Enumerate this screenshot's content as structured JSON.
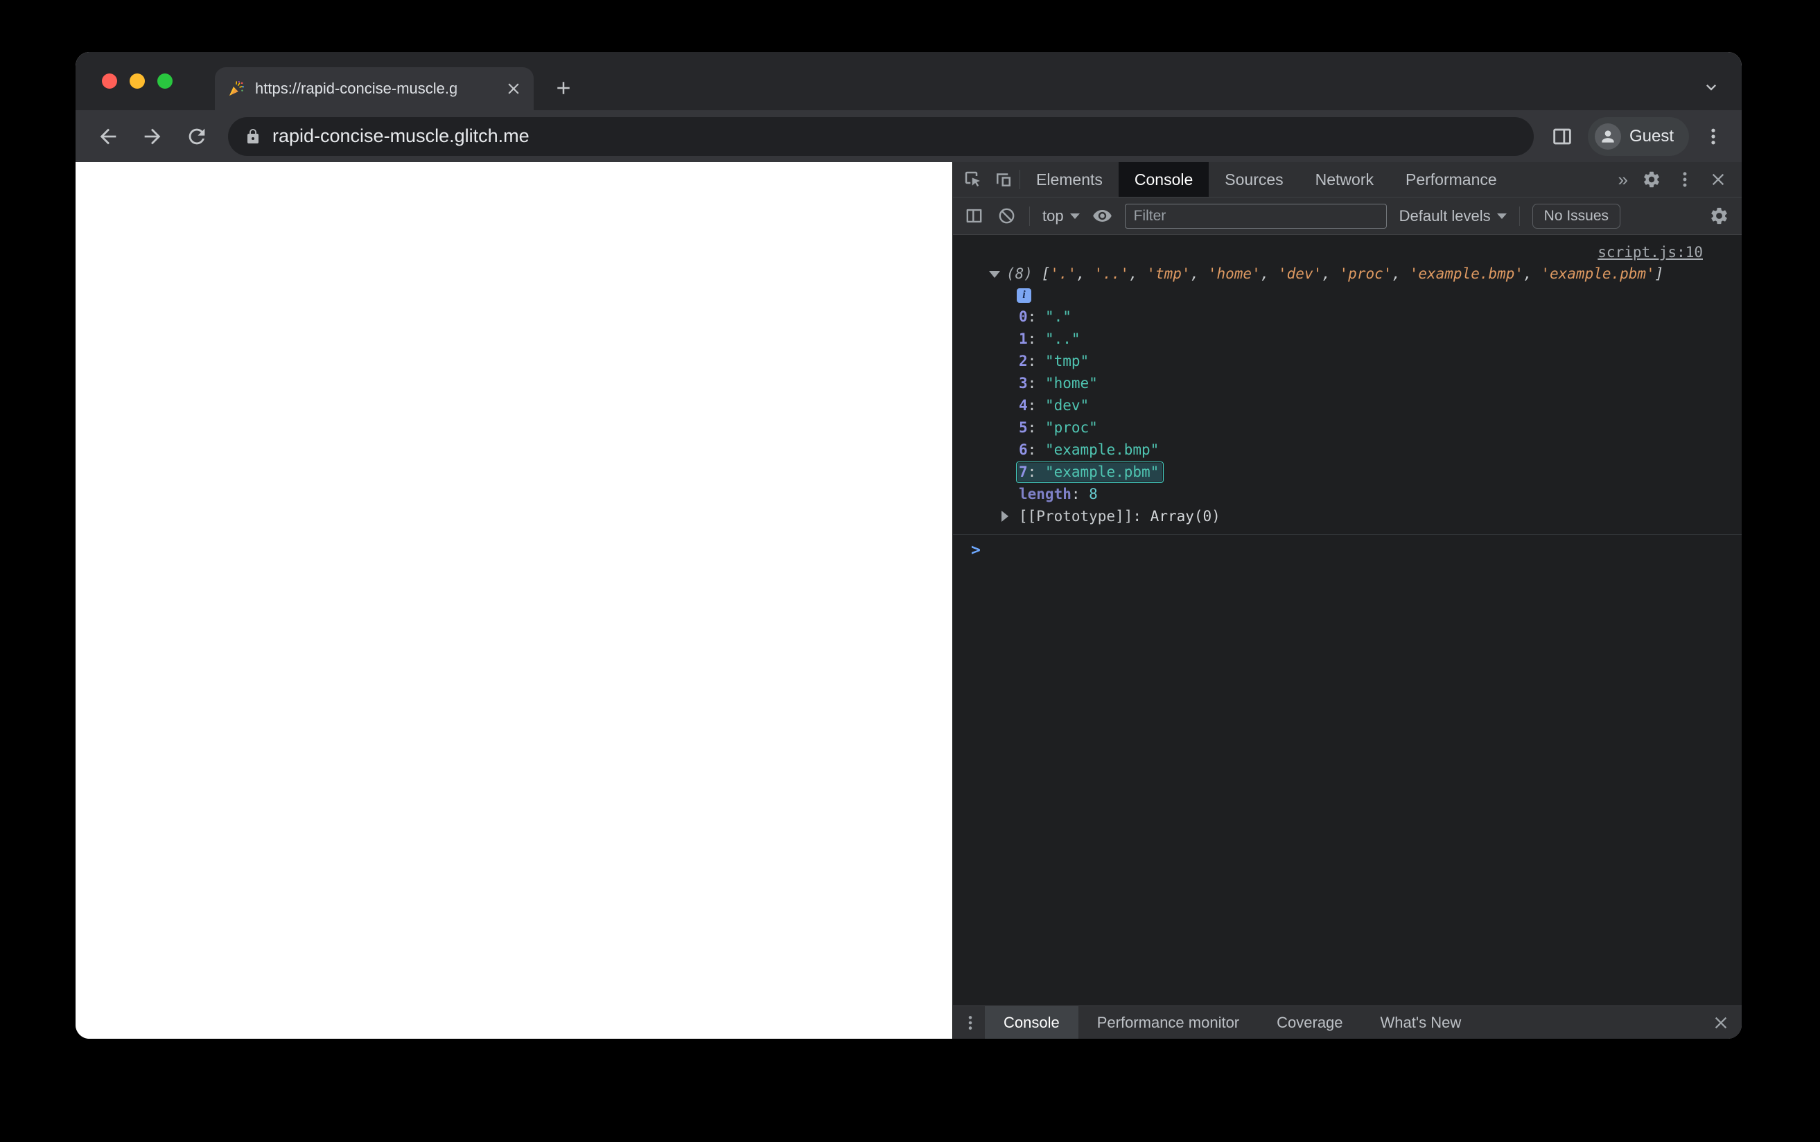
{
  "browser": {
    "tab_title": "https://rapid-concise-muscle.g",
    "url": "rapid-concise-muscle.glitch.me",
    "profile_label": "Guest"
  },
  "devtools": {
    "panel_tabs": [
      "Elements",
      "Console",
      "Sources",
      "Network",
      "Performance"
    ],
    "active_panel_tab": "Console",
    "more_tabs": "»",
    "toolbar": {
      "context": "top",
      "filter_placeholder": "Filter",
      "levels": "Default levels",
      "issues": "No Issues"
    },
    "console": {
      "source_link": "script.js:10",
      "summary_count": "(8)",
      "bracket_open": " [",
      "bracket_close": "]",
      "summary_items": [
        "'.'",
        "'..'",
        "'tmp'",
        "'home'",
        "'dev'",
        "'proc'",
        "'example.bmp'",
        "'example.pbm'"
      ],
      "info_badge": "i",
      "separator": ": ",
      "entries": [
        {
          "key": "0",
          "value": "\".\""
        },
        {
          "key": "1",
          "value": "\"..\""
        },
        {
          "key": "2",
          "value": "\"tmp\""
        },
        {
          "key": "3",
          "value": "\"home\""
        },
        {
          "key": "4",
          "value": "\"dev\""
        },
        {
          "key": "5",
          "value": "\"proc\""
        },
        {
          "key": "6",
          "value": "\"example.bmp\""
        },
        {
          "key": "7",
          "value": "\"example.pbm\"",
          "highlight": true
        }
      ],
      "length_label": "length",
      "length_value": "8",
      "prototype_label": "[[Prototype]]",
      "prototype_value": "Array(0)",
      "prompt": ">"
    },
    "drawer_tabs": [
      "Console",
      "Performance monitor",
      "Coverage",
      "What's New"
    ],
    "active_drawer_tab": "Console"
  },
  "colors": {
    "key": "#9093e6",
    "string_expanded": "#4fc5b2",
    "string_preview": "#df9a62",
    "number": "#68cdd0",
    "prompt": "#6ea8fe",
    "highlight_border": "#43d0c3",
    "traffic_red": "#ff5f57",
    "traffic_yellow": "#febc2e",
    "traffic_green": "#29c73f"
  }
}
